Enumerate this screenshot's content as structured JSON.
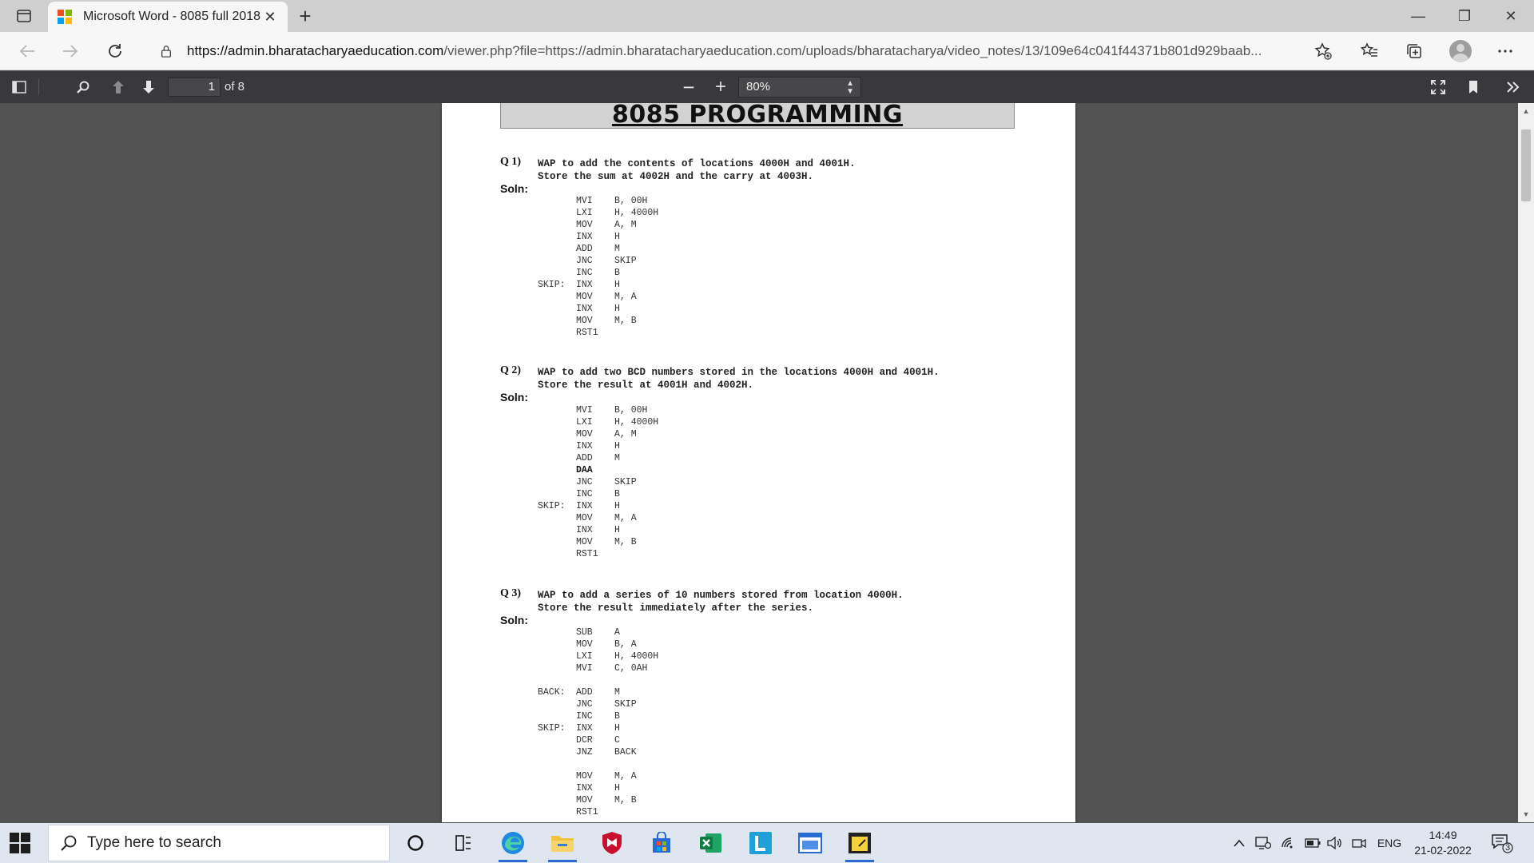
{
  "browser": {
    "tab_title": "Microsoft Word - 8085 full 2018.",
    "tab_close": "✕",
    "new_tab": "+",
    "url_host": "https://admin.bharatacharyaeducation.com",
    "url_rest": "/viewer.php?file=https://admin.bharatacharyaeducation.com/uploads/bharatacharya/video_notes/13/109e64c041f44371b801d929baab...",
    "window_controls": [
      "—",
      "❐",
      "✕"
    ]
  },
  "pdf_toolbar": {
    "page_number": "1",
    "page_count": "of 8",
    "zoom_value": "80%",
    "zoom_out": "−",
    "zoom_in": "+"
  },
  "document": {
    "title": "8085 PROGRAMMING",
    "soln_label": "Soln:",
    "questions": [
      {
        "number": "Q 1)",
        "text": "WAP to add the contents of locations 4000H and 4001H.\nStore the sum at 4002H and the carry at 4003H.",
        "code": [
          {
            "label": "",
            "op": "MVI",
            "arg": "B, 00H"
          },
          {
            "label": "",
            "op": "LXI",
            "arg": "H, 4000H"
          },
          {
            "label": "",
            "op": "MOV",
            "arg": "A, M"
          },
          {
            "label": "",
            "op": "INX",
            "arg": "H"
          },
          {
            "label": "",
            "op": "ADD",
            "arg": "M"
          },
          {
            "label": "",
            "op": "JNC",
            "arg": "SKIP"
          },
          {
            "label": "",
            "op": "INC",
            "arg": "B"
          },
          {
            "label": "SKIP:",
            "op": "INX",
            "arg": "H"
          },
          {
            "label": "",
            "op": "MOV",
            "arg": "M, A"
          },
          {
            "label": "",
            "op": "INX",
            "arg": "H"
          },
          {
            "label": "",
            "op": "MOV",
            "arg": "M, B"
          },
          {
            "label": "",
            "op": "RST1",
            "arg": ""
          }
        ]
      },
      {
        "number": "Q 2)",
        "text": "WAP to add two BCD numbers stored in the locations 4000H and 4001H.\nStore the result at 4001H and 4002H.",
        "code": [
          {
            "label": "",
            "op": "MVI",
            "arg": "B, 00H"
          },
          {
            "label": "",
            "op": "LXI",
            "arg": "H, 4000H"
          },
          {
            "label": "",
            "op": "MOV",
            "arg": "A, M"
          },
          {
            "label": "",
            "op": "INX",
            "arg": "H"
          },
          {
            "label": "",
            "op": "ADD",
            "arg": "M"
          },
          {
            "label": "",
            "op": "DAA",
            "arg": "",
            "bold": true
          },
          {
            "label": "",
            "op": "JNC",
            "arg": "SKIP"
          },
          {
            "label": "",
            "op": "INC",
            "arg": "B"
          },
          {
            "label": "SKIP:",
            "op": "INX",
            "arg": "H"
          },
          {
            "label": "",
            "op": "MOV",
            "arg": "M, A"
          },
          {
            "label": "",
            "op": "INX",
            "arg": "H"
          },
          {
            "label": "",
            "op": "MOV",
            "arg": "M, B"
          },
          {
            "label": "",
            "op": "RST1",
            "arg": ""
          }
        ]
      },
      {
        "number": "Q 3)",
        "text": "WAP to add a series of 10 numbers stored from location 4000H.\nStore the result immediately after the series.",
        "code": [
          {
            "label": "",
            "op": "SUB",
            "arg": "A"
          },
          {
            "label": "",
            "op": "MOV",
            "arg": "B, A"
          },
          {
            "label": "",
            "op": "LXI",
            "arg": "H, 4000H"
          },
          {
            "label": "",
            "op": "MVI",
            "arg": "C, 0AH"
          },
          {
            "label": "",
            "op": "",
            "arg": ""
          },
          {
            "label": "BACK:",
            "op": "ADD",
            "arg": "M"
          },
          {
            "label": "",
            "op": "JNC",
            "arg": "SKIP"
          },
          {
            "label": "",
            "op": "INC",
            "arg": "B"
          },
          {
            "label": "SKIP:",
            "op": "INX",
            "arg": "H"
          },
          {
            "label": "",
            "op": "DCR",
            "arg": "C"
          },
          {
            "label": "",
            "op": "JNZ",
            "arg": "BACK"
          },
          {
            "label": "",
            "op": "",
            "arg": ""
          },
          {
            "label": "",
            "op": "MOV",
            "arg": "M, A"
          },
          {
            "label": "",
            "op": "INX",
            "arg": "H"
          },
          {
            "label": "",
            "op": "MOV",
            "arg": "M, B"
          },
          {
            "label": "",
            "op": "RST1",
            "arg": ""
          }
        ]
      }
    ]
  },
  "taskbar": {
    "search_placeholder": "Type here to search",
    "language": "ENG",
    "time": "14:49",
    "date": "21-02-2022",
    "notification_count": "3"
  },
  "colors": {
    "tab_strip": "#cfcfcf",
    "pdf_toolbar": "#38383d",
    "viewer_bg": "#525252",
    "taskbar": "#dfe6f0",
    "accent": "#2a6bd1"
  }
}
